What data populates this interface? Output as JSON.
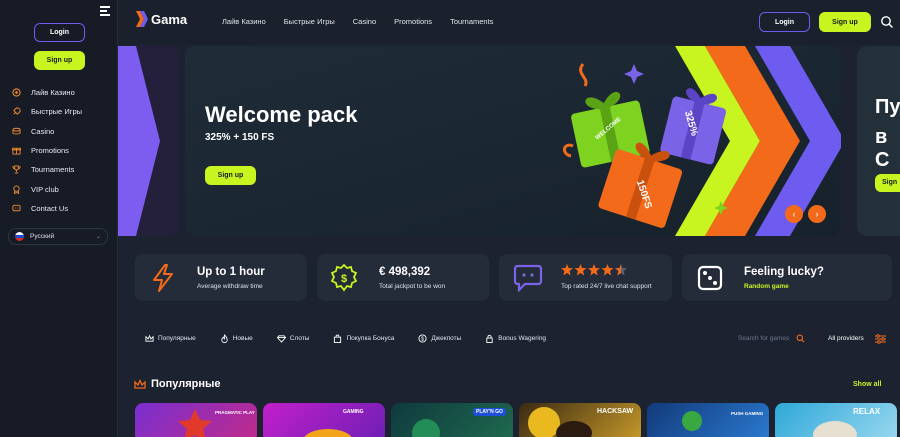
{
  "sidebar": {
    "login_label": "Login",
    "signup_label": "Sign up",
    "items": [
      {
        "label": "Лайв Казино",
        "icon": "live-casino-icon"
      },
      {
        "label": "Быстрые Игры",
        "icon": "rocket-icon"
      },
      {
        "label": "Casino",
        "icon": "chips-icon"
      },
      {
        "label": "Promotions",
        "icon": "gift-icon"
      },
      {
        "label": "Tournaments",
        "icon": "trophy-icon"
      },
      {
        "label": "VIP club",
        "icon": "vip-badge-icon"
      },
      {
        "label": "Contact Us",
        "icon": "chat-icon"
      }
    ],
    "language": "Русский"
  },
  "header": {
    "logo": "Gama",
    "nav": [
      "Лайв Казино",
      "Быстрые Игры",
      "Casino",
      "Promotions",
      "Tournaments"
    ],
    "login_label": "Login",
    "signup_label": "Sign up"
  },
  "banner": {
    "title": "Welcome pack",
    "subtitle": "325% + 150 FS",
    "cta": "Sign up",
    "gift_labels": [
      "325%",
      "150FS",
      "WELCOME"
    ],
    "next_title_lines": [
      "Пу",
      "в С"
    ],
    "next_cta": "Sign"
  },
  "features": [
    {
      "title": "Up to 1 hour",
      "sub": "Average withdraw time",
      "icon": "lightning-icon"
    },
    {
      "title": "€ 498,392",
      "sub": "Total jackpot to be won",
      "icon": "dollar-badge-icon"
    },
    {
      "title": "",
      "sub": "Top rated 24/7 live chat support",
      "icon": "chat-bubble-icon",
      "rating": 4.5
    },
    {
      "title": "Feeling lucky?",
      "sub": "Random game",
      "icon": "dice-icon"
    }
  ],
  "categories": [
    {
      "label": "Популярные",
      "icon": "crown-icon"
    },
    {
      "label": "Новые",
      "icon": "flame-icon"
    },
    {
      "label": "Слоты",
      "icon": "diamond-icon"
    },
    {
      "label": "Покупка Бонуса",
      "icon": "bag-icon"
    },
    {
      "label": "Джекпоты",
      "icon": "coin-icon"
    },
    {
      "label": "Bonus Wagering",
      "icon": "lock-icon"
    }
  ],
  "search_placeholder": "Search for games",
  "providers_label": "All providers",
  "popular": {
    "title": "Популярные",
    "show_all": "Show all",
    "tile_providers": [
      "PRAGMATIC PLAY",
      "GAMING",
      "PLAY'N GO",
      "HACKSAW",
      "PUSH GAMING",
      "RELAX"
    ]
  },
  "colors": {
    "accent": "#c8f51f",
    "brand": "#6e5cf0",
    "orange": "#f26a1a"
  }
}
